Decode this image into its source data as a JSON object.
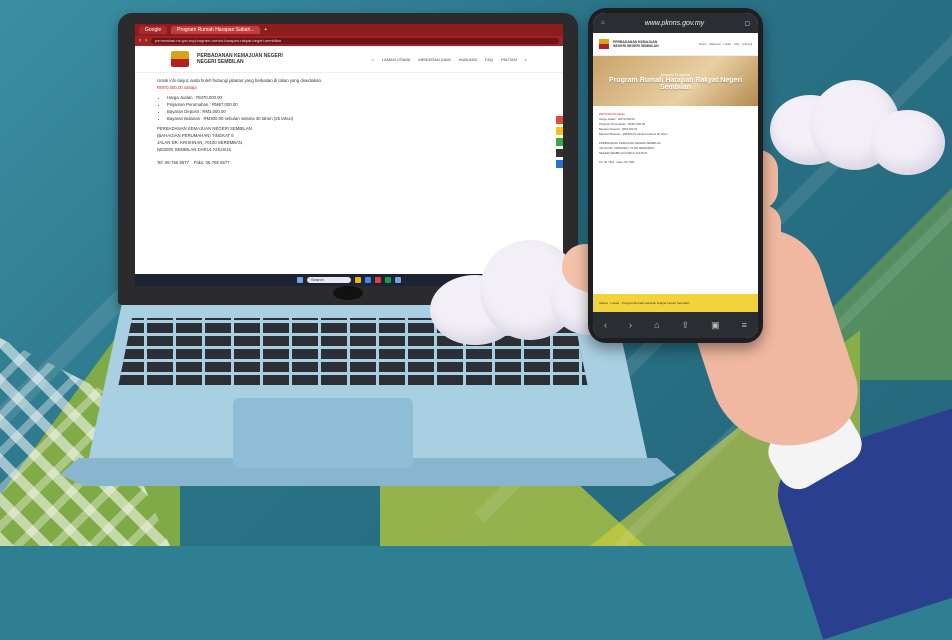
{
  "laptop": {
    "tabs": [
      "Google",
      "Program Rumah Harapan Sabah...",
      "+"
    ],
    "url": "perumahan.ns.gov.my/program-rumah-harapan-rakyat-negeri-sembilan",
    "site_title_line1": "PERBADANAN KEMAJUAN NEGERI",
    "site_title_line2": "NEGERI SEMBILAN",
    "nav": [
      "LAMAN UTAMA",
      "MENGENAI KAMI",
      "HUBUNGI",
      "FAQ",
      "PAUTAN"
    ],
    "paragraph1": "Untuk info lanjut, anda boleh hubungi jabatan yang berkaitan di talian yang disediakan.",
    "paragraph2_red": "RM70,000.00 sahaja",
    "bullets": [
      "Harga Jualan : RM70,000.00",
      "Pinjaman Perumahan : RM67,000.00",
      "Bayaran Deposit : RM3,000.00",
      "Bayaran Bulanan : RM300.00 sebulan selama 30 tahun (25 tahun)"
    ],
    "address_lines": [
      "PERBADANAN KEMAJUAN NEGERI SEMBILAN",
      "(BAHAGIAN PERUMAHAN) TINGKAT 6",
      "JALAN DR. KRISHNAN, 70100 SEREMBAN,",
      "NEGERI SEMBILAN DARUL KHUSUS"
    ],
    "tel": "Tel: 06-766 5577",
    "fax": "Faks: 06-766 5577",
    "taskbar_search": "Search"
  },
  "phone": {
    "url": "www.pknns.gov.my",
    "site_title": "PERBADANAN KEMAJUAN NEGERI NEGERI SEMBILAN",
    "nav": [
      "Utama",
      "Maklumat",
      "Lokasi",
      "FAQ",
      "Hubungi"
    ],
    "banner_small": "Inisiatif Program",
    "banner_big": "Program Rumah Harapan Rakyat Negeri Sembilan",
    "text_lines": [
      "Harga Jualan : RM70,000.00",
      "Pinjaman Perumahan : RM67,000.00",
      "Bayaran Deposit : RM3,000.00",
      "Bayaran Bulanan : RM300.00 sebulan selama 30 tahun"
    ],
    "red_text": "RM70,000.00 sahaja",
    "address_lines": [
      "PERBADANAN KEMAJUAN NEGERI SEMBILAN",
      "JALAN DR. KRISHNAN, 70100 SEREMBAN",
      "NEGERI SEMBILAN DARUL KHUSUS"
    ],
    "contact": "Tel: 06-7611 · Faks: 06-7661",
    "footer_bar": "Utama · Lokasi · Program Rumah Harapan Rakyat Negeri Sembilan",
    "nav_icons": [
      "back-icon",
      "forward-icon",
      "home-icon",
      "share-icon",
      "tabs-icon",
      "menu-icon"
    ]
  },
  "colors": {
    "background": "#2f7f93",
    "browser_red": "#8c1d1d",
    "phone_banner": "#c9a36a",
    "footer_yellow": "#f2d33b",
    "sleeve_blue": "#2b3f8f"
  }
}
